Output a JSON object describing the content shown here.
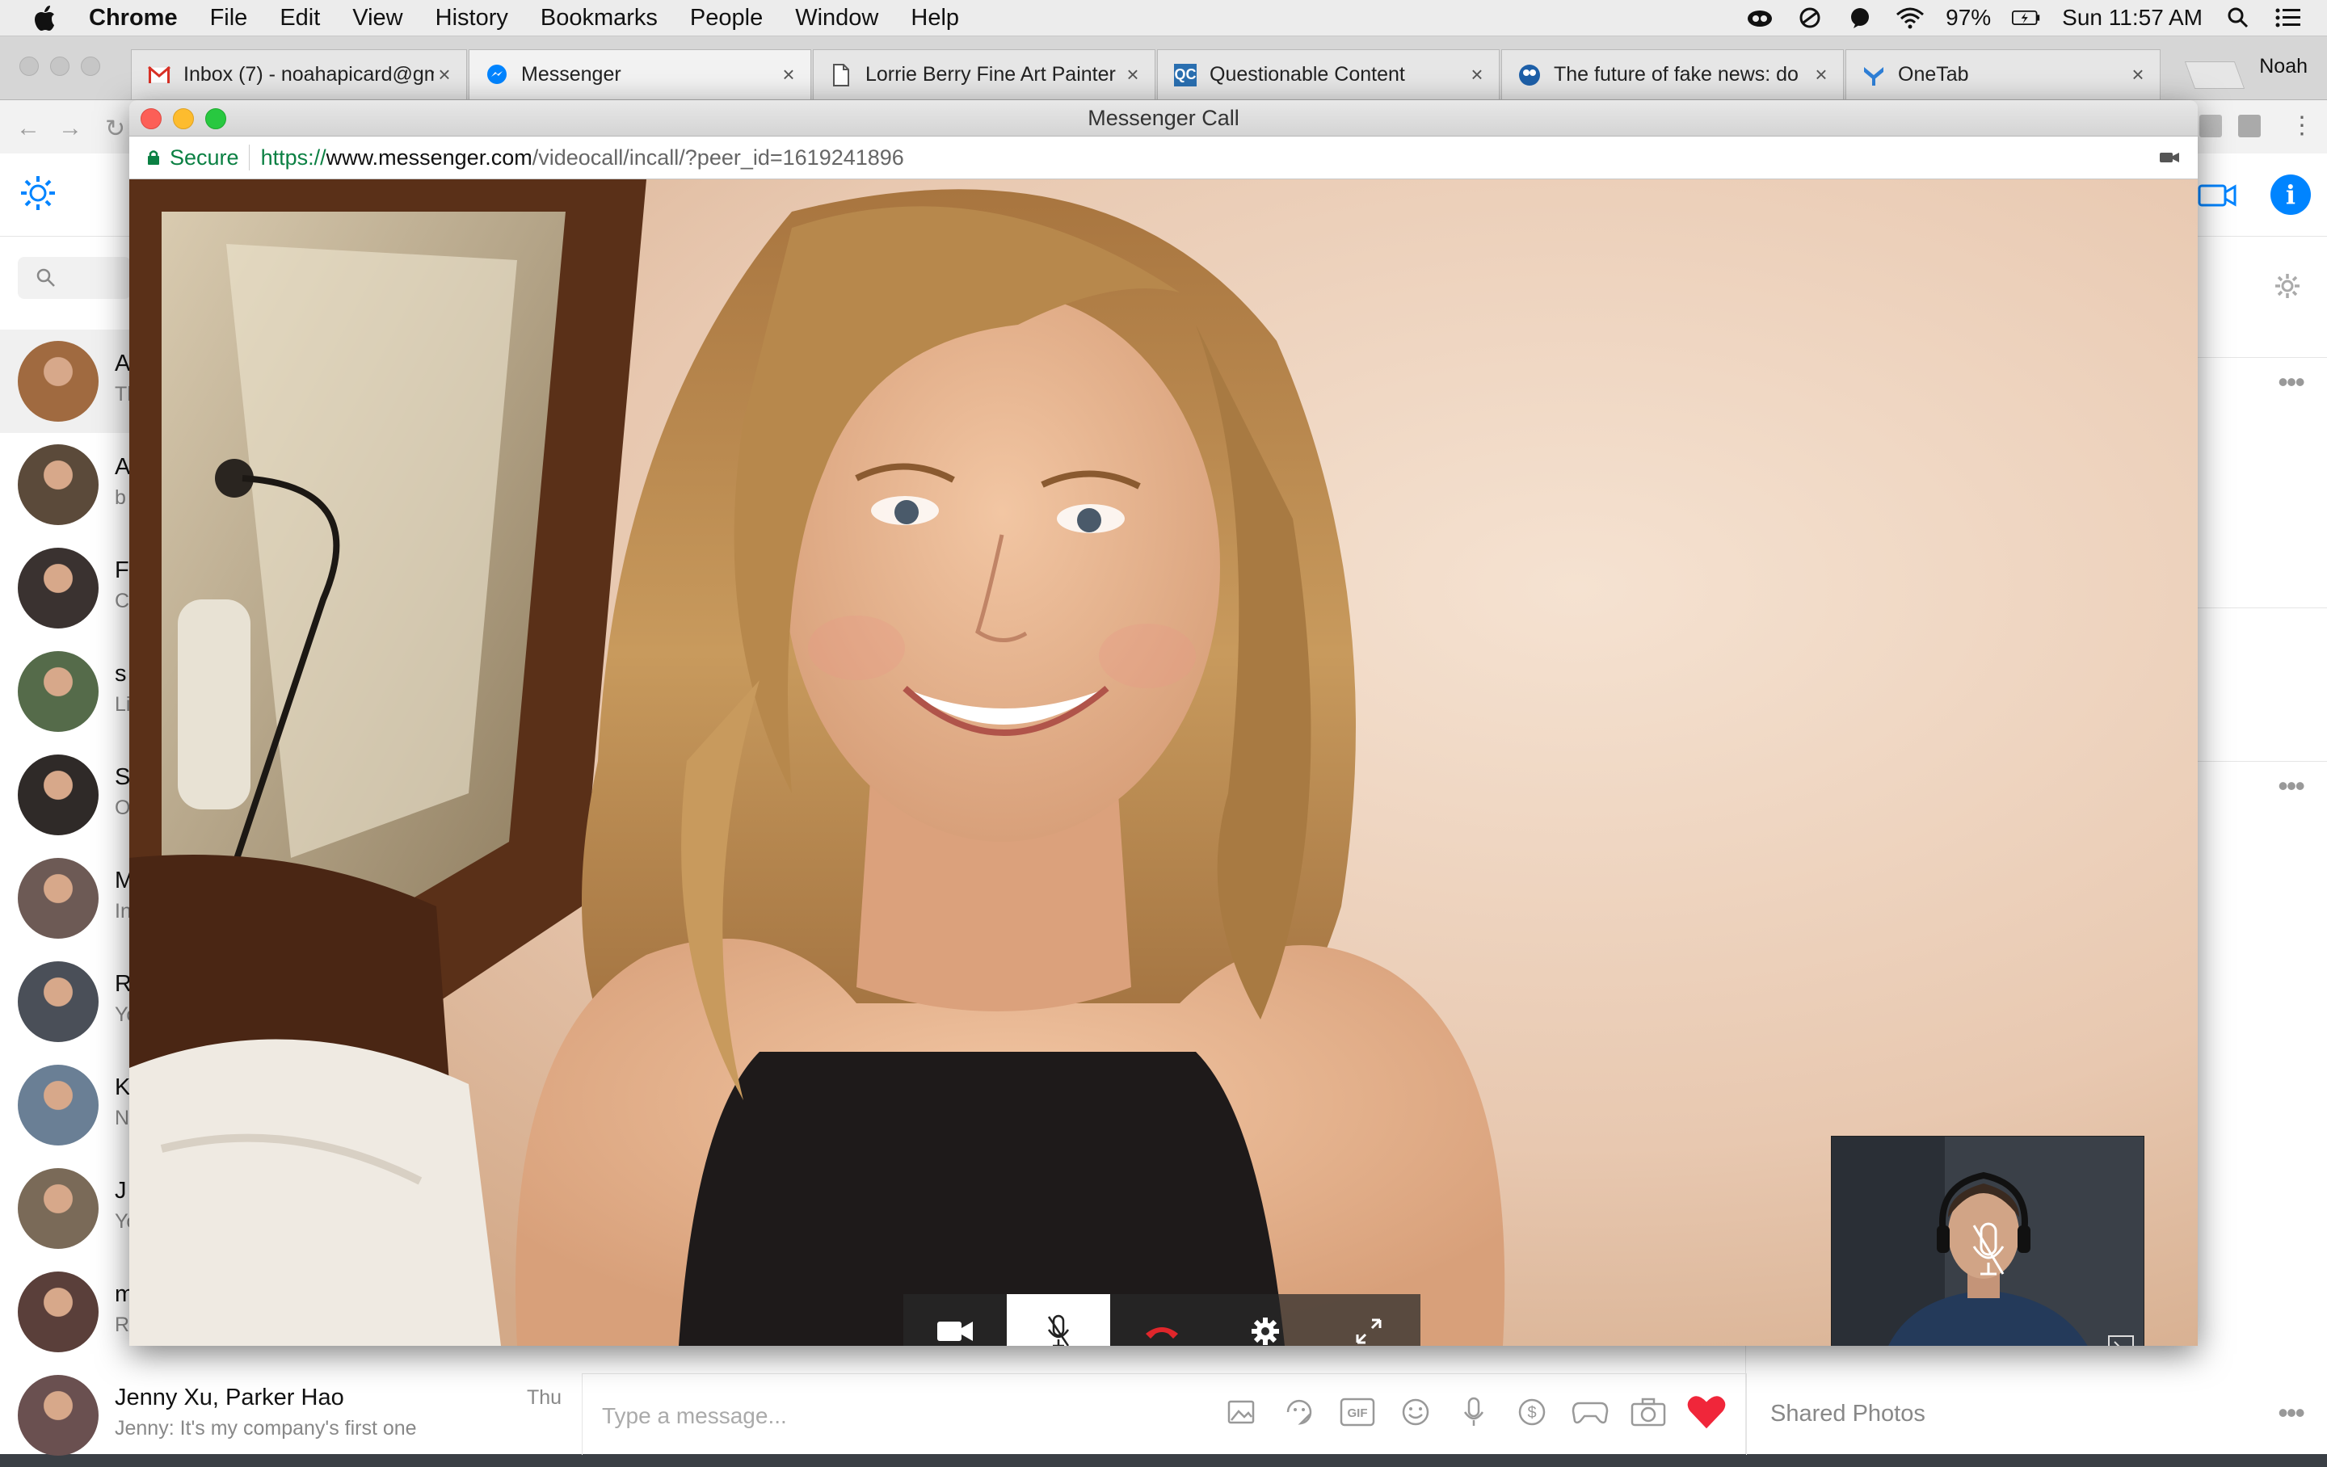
{
  "menubar": {
    "app_name": "Chrome",
    "items": [
      "File",
      "Edit",
      "View",
      "History",
      "Bookmarks",
      "People",
      "Window",
      "Help"
    ],
    "battery": "97%",
    "clock": "Sun 11:57 AM"
  },
  "tabs": [
    {
      "title": "Inbox (7) - noahapicard@gm",
      "favicon": "gmail-icon",
      "active": false
    },
    {
      "title": "Messenger",
      "favicon": "messenger-icon",
      "active": true
    },
    {
      "title": "Lorrie Berry Fine Art Painter",
      "favicon": "document-icon",
      "active": false
    },
    {
      "title": "Questionable Content",
      "favicon": "qc-icon",
      "active": false
    },
    {
      "title": "The future of fake news: do",
      "favicon": "site-icon",
      "active": false
    },
    {
      "title": "OneTab",
      "favicon": "onetab-icon",
      "active": false
    }
  ],
  "profile_name": "Noah",
  "popup": {
    "title": "Messenger Call",
    "secure_label": "Secure",
    "url_scheme": "https://",
    "url_host": "www.messenger.com",
    "url_path": "/videocall/incall/?peer_id=1619241896"
  },
  "call_controls": [
    "video-camera-icon",
    "microphone-muted-icon",
    "hang-up-icon",
    "settings-icon",
    "fullscreen-icon"
  ],
  "conversations": [
    {
      "name": "A",
      "snippet": "Th",
      "time": "",
      "selected": true,
      "avatar_color": "#a06a40"
    },
    {
      "name": "A",
      "snippet": "b",
      "time": "",
      "selected": false,
      "avatar_color": "#5b4a3a"
    },
    {
      "name": "F",
      "snippet": "C",
      "time": "",
      "selected": false,
      "avatar_color": "#3a3230"
    },
    {
      "name": "s",
      "snippet": "Li",
      "time": "",
      "selected": false,
      "avatar_color": "#556b4a"
    },
    {
      "name": "S",
      "snippet": "O",
      "time": "",
      "selected": false,
      "avatar_color": "#2f2a28"
    },
    {
      "name": "M",
      "snippet": "In",
      "time": "",
      "selected": false,
      "avatar_color": "#6d5a55"
    },
    {
      "name": "R",
      "snippet": "Yo",
      "time": "",
      "selected": false,
      "avatar_color": "#4a4f58"
    },
    {
      "name": "K",
      "snippet": "N",
      "time": "",
      "selected": false,
      "avatar_color": "#6a7f95"
    },
    {
      "name": "J",
      "snippet": "Yo",
      "time": "",
      "selected": false,
      "avatar_color": "#7a6a58"
    },
    {
      "name": "m",
      "snippet": "R",
      "time": "",
      "selected": false,
      "avatar_color": "#5a3f3a"
    },
    {
      "name": "Jenny Xu, Parker Hao",
      "snippet": "Jenny: It's my company's first one",
      "time": "Thu",
      "selected": false,
      "avatar_color": "#6a5050"
    }
  ],
  "composer": {
    "placeholder": "Type a message..."
  },
  "right_panel": {
    "shared_photos": "Shared Photos"
  },
  "colors": {
    "messenger_blue": "#0084ff",
    "secure_green": "#0b8043",
    "hangup_red": "#e0262b",
    "heart_red": "#f0263a"
  }
}
